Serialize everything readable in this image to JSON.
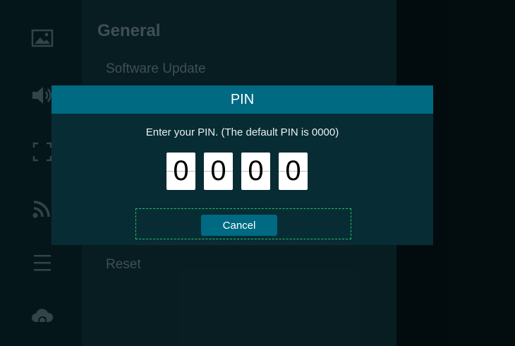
{
  "sidebar": {
    "icons": [
      "picture-icon",
      "sound-icon",
      "screen-fit-icon",
      "network-icon",
      "menu-icon",
      "cloud-sync-icon"
    ]
  },
  "panel": {
    "title": "General",
    "items": [
      {
        "label": "Software Update"
      },
      {
        "label": "Reset"
      }
    ]
  },
  "dialog": {
    "title": "PIN",
    "message": "Enter your PIN. (The default PIN is 0000)",
    "pin_digits": [
      "0",
      "0",
      "0",
      "0"
    ],
    "cancel_label": "Cancel"
  },
  "colors": {
    "accent": "#006a83",
    "dialog_bg": "#082c34",
    "focus": "#23c46a"
  }
}
